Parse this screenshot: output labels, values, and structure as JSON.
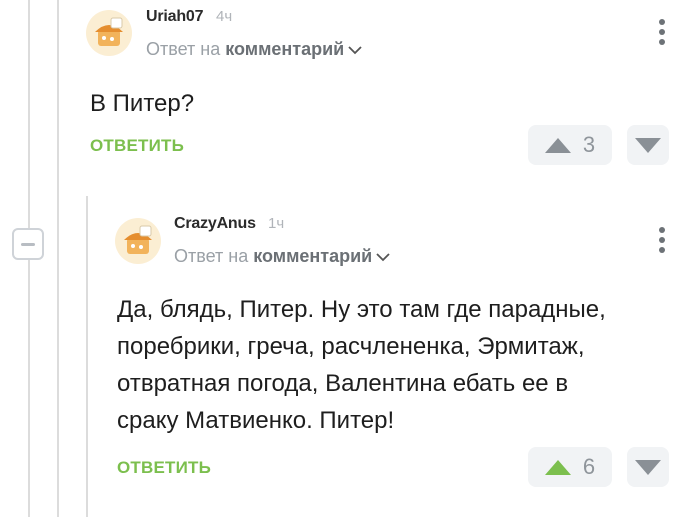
{
  "colors": {
    "accent_green": "#7cbf4e",
    "arrow_gray": "#8a9096",
    "vote_bg": "#f1f3f5",
    "thread_line": "#dcdcdc"
  },
  "comments": [
    {
      "username": "Uriah07",
      "time": "4ч",
      "reply_prefix": "Ответ на",
      "reply_target": "комментарий",
      "text_lines": [
        "В Питер?"
      ],
      "reply_label": "ОТВЕТИТЬ",
      "rating": "3",
      "upvoted": false
    },
    {
      "username": "CrazyAnus",
      "time": "1ч",
      "reply_prefix": "Ответ на",
      "reply_target": "комментарий",
      "text_lines": [
        "Да, блядь, Питер. Ну это там где парадные,",
        "поребрики, греча, расчлененка, Эрмитаж,",
        "отвратная погода, Валентина ебать ее в",
        "сраку Матвиенко. Питер!"
      ],
      "reply_label": "ОТВЕТИТЬ",
      "rating": "6",
      "upvoted": true
    }
  ]
}
